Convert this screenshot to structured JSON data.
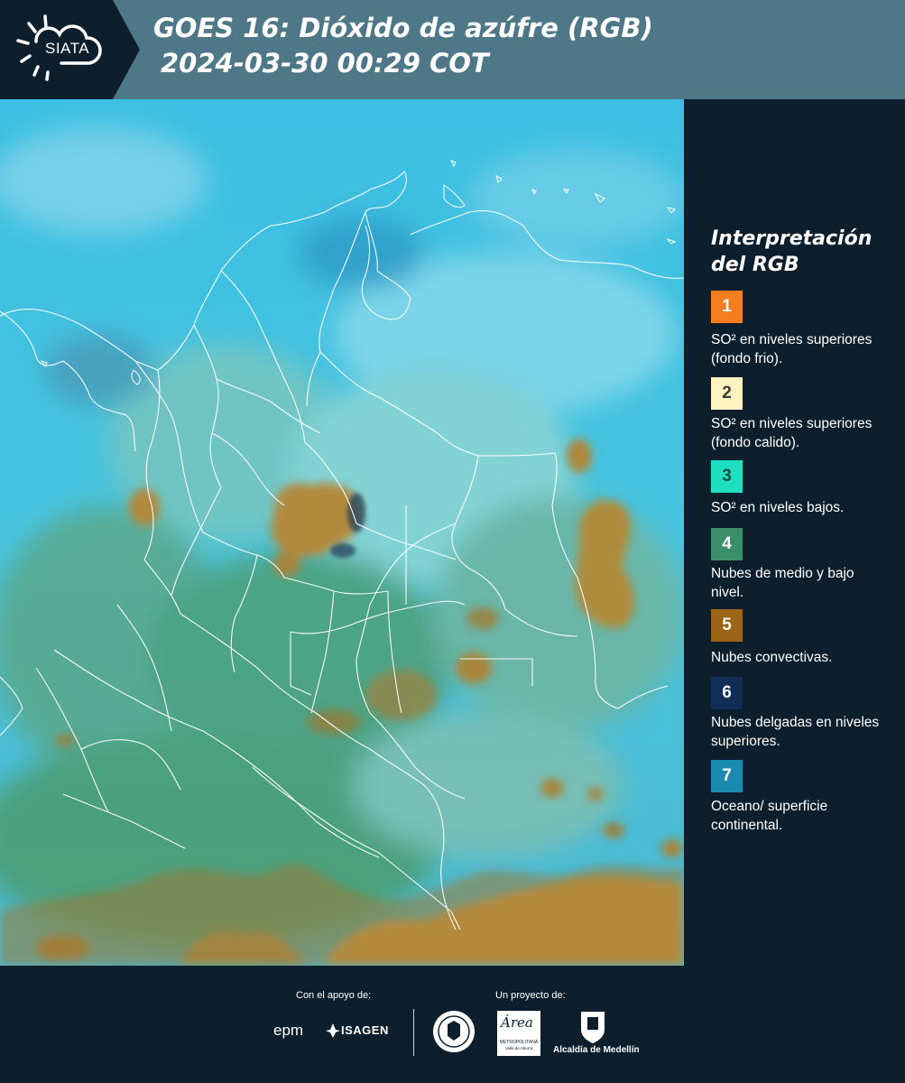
{
  "header": {
    "logo_text": "SIATA",
    "title_line1": "GOES 16: Dióxido de azúfre (RGB)",
    "title_line2": "2024-03-30 00:29 COT"
  },
  "legend": {
    "title": "Interpretación del RGB",
    "items": [
      {
        "number": "1",
        "color": "#f57c1f",
        "text": "SO² en niveles superiores (fondo frio)."
      },
      {
        "number": "2",
        "color": "#fff3c2",
        "text": "SO² en niveles superiores (fondo calido)."
      },
      {
        "number": "3",
        "color": "#1ee0c0",
        "text": "SO² en niveles bajos."
      },
      {
        "number": "4",
        "color": "#3a8f6a",
        "text": "Nubes de medio y bajo nivel."
      },
      {
        "number": "5",
        "color": "#9a6514",
        "text": "Nubes convectivas."
      },
      {
        "number": "6",
        "color": "#0f2d57",
        "text": "Nubes delgadas en niveles superiores."
      },
      {
        "number": "7",
        "color": "#1a8ab0",
        "text": "Oceano/ superficie continental."
      }
    ]
  },
  "footer": {
    "support_label": "Con el apoyo de:",
    "project_label": "Un proyecto de:",
    "sponsor_epm": "epm",
    "sponsor_isagen": "ISAGEN",
    "metropolitana_script": "Área",
    "metropolitana_name": "METROPOLITANA",
    "metropolitana_sub": "Valle de Aburrá",
    "alcaldia": "Alcaldía de Medellín"
  },
  "colors": {
    "header_bg": "#4e7788",
    "panel_bg": "#0d1f2d",
    "sky_cyan": "#3cc2e6",
    "convective": "#a07a2c"
  }
}
